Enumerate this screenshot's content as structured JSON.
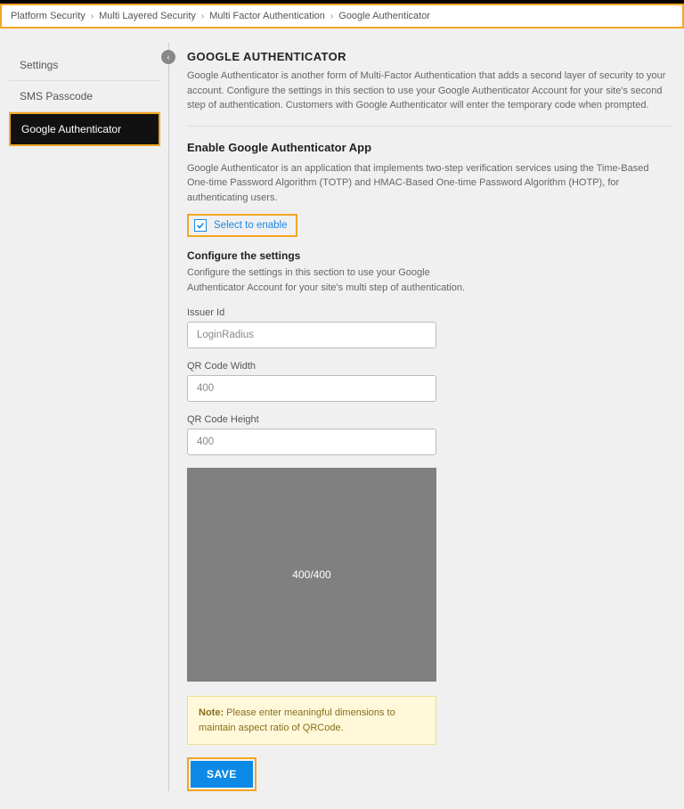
{
  "breadcrumb": {
    "items": [
      "Platform Security",
      "Multi Layered Security",
      "Multi Factor Authentication",
      "Google Authenticator"
    ]
  },
  "sidebar": {
    "items": [
      {
        "label": "Settings",
        "active": false
      },
      {
        "label": "SMS Passcode",
        "active": false
      },
      {
        "label": "Google Authenticator",
        "active": true
      }
    ]
  },
  "collapse_icon": "‹",
  "page": {
    "title": "GOOGLE AUTHENTICATOR",
    "description": "Google Authenticator is another form of Multi-Factor Authentication that adds a second layer of security to your account. Configure the settings in this section to use your Google Authenticator Account for your site's second step of authentication. Customers with Google Authenticator will enter the temporary code when prompted."
  },
  "enable_section": {
    "title": "Enable Google Authenticator App",
    "description": "Google Authenticator is an application that implements two-step verification services using the Time-Based One-time Password Algorithm (TOTP) and HMAC-Based One-time Password Algorithm (HOTP), for authenticating users.",
    "checkbox_label": "Select to enable",
    "checked": true
  },
  "configure": {
    "title": "Configure the settings",
    "description": "Configure the settings in this section to use your Google Authenticator Account for your site's multi step of authentication."
  },
  "fields": {
    "issuer": {
      "label": "Issuer Id",
      "value": "LoginRadius"
    },
    "width": {
      "label": "QR Code Width",
      "value": "400"
    },
    "height": {
      "label": "QR Code Height",
      "value": "400"
    }
  },
  "qr_preview_text": "400/400",
  "note": {
    "prefix": "Note:",
    "text": " Please enter meaningful dimensions to maintain aspect ratio of QRCode."
  },
  "save_label": "SAVE"
}
